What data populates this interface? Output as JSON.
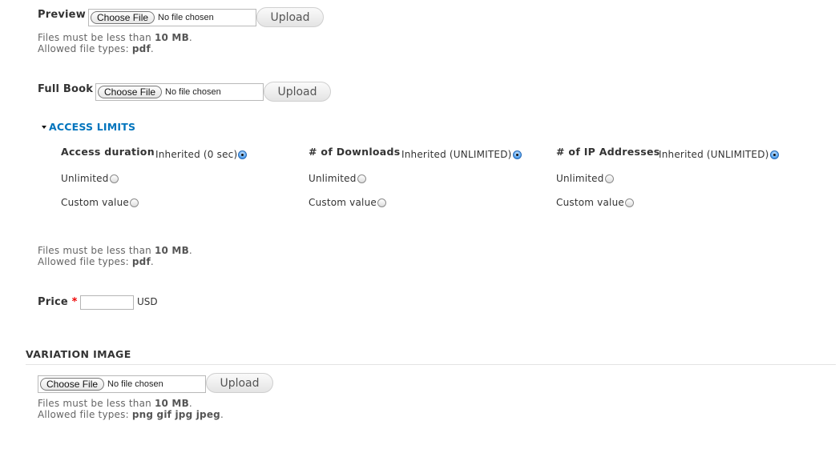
{
  "preview": {
    "label": "Preview",
    "choose_file_label": "Choose File",
    "file_status": "No file chosen",
    "upload_label": "Upload",
    "size_prefix": "Files must be less than ",
    "size_value": "10 MB",
    "size_suffix": ".",
    "types_prefix": "Allowed file types: ",
    "types_value": "pdf",
    "types_suffix": "."
  },
  "full_book": {
    "label": "Full Book",
    "choose_file_label": "Choose File",
    "file_status": "No file chosen",
    "upload_label": "Upload",
    "size_prefix": "Files must be less than ",
    "size_value": "10 MB",
    "size_suffix": ".",
    "types_prefix": "Allowed file types: ",
    "types_value": "pdf",
    "types_suffix": "."
  },
  "access_limits": {
    "title": "ACCESS LIMITS",
    "expanded": true,
    "groups": [
      {
        "title": "Access duration",
        "options": [
          {
            "label": "Inherited (0 sec)",
            "checked": true
          },
          {
            "label": "Unlimited",
            "checked": false
          },
          {
            "label": "Custom value",
            "checked": false
          }
        ]
      },
      {
        "title": "# of Downloads",
        "options": [
          {
            "label": "Inherited (UNLIMITED)",
            "checked": true
          },
          {
            "label": "Unlimited",
            "checked": false
          },
          {
            "label": "Custom value",
            "checked": false
          }
        ]
      },
      {
        "title": "# of IP Addresses",
        "options": [
          {
            "label": "Inherited (UNLIMITED)",
            "checked": true
          },
          {
            "label": "Unlimited",
            "checked": false
          },
          {
            "label": "Custom value",
            "checked": false
          }
        ]
      }
    ]
  },
  "price": {
    "label": "Price",
    "required_marker": "*",
    "value": "",
    "currency": "USD"
  },
  "variation_image": {
    "title": "VARIATION IMAGE",
    "choose_file_label": "Choose File",
    "file_status": "No file chosen",
    "upload_label": "Upload",
    "size_prefix": "Files must be less than ",
    "size_value": "10 MB",
    "size_suffix": ".",
    "types_prefix": "Allowed file types: ",
    "types_value": "png gif jpg jpeg",
    "types_suffix": "."
  },
  "colors": {
    "link_accent": "#0074bd",
    "required": "#ee0000",
    "radio_checked": "#2f7fd6"
  }
}
